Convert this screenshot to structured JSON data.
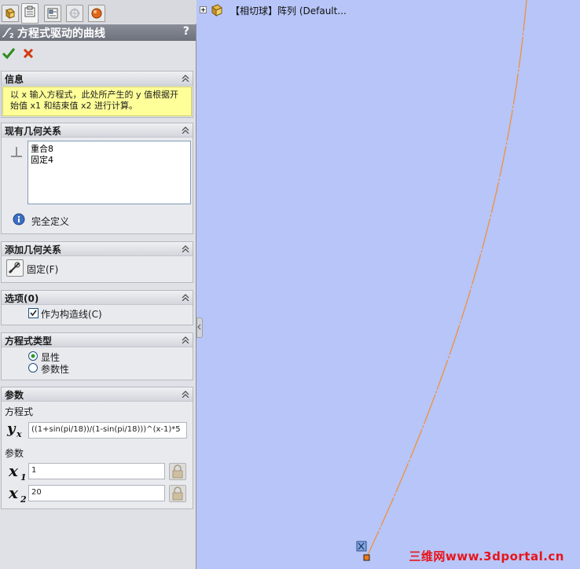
{
  "panel": {
    "title": "方程式驱动的曲线",
    "help": "?",
    "info": {
      "header": "信息",
      "message": "以 x 输入方程式，此处所产生的 y 值根据开始值 x1 和结束值 x2 进行计算。"
    },
    "existing_relations": {
      "header": "现有几何关系",
      "items": [
        "重合8",
        "固定4"
      ],
      "status": "完全定义"
    },
    "add_relations": {
      "header": "添加几何关系",
      "button_label": "固定(F)"
    },
    "options": {
      "header": "选项(0)",
      "construction_label": "作为构造线(C)",
      "construction_checked": true
    },
    "equation_type": {
      "header": "方程式类型",
      "explicit": "显性",
      "parametric": "参数性",
      "selected": "explicit"
    },
    "parameters": {
      "header": "参数",
      "equation_label": "方程式",
      "equation_value": "((1+sin(pi/18))/(1-sin(pi/18)))^(x-1)*5",
      "params_label": "参数",
      "x1_value": "1",
      "x2_value": "20"
    }
  },
  "tree": {
    "label": "【相切球】阵列  (Default..."
  },
  "watermark": "三维网www.3dportal.cn",
  "colors": {
    "canvas": "#b7c5f8",
    "curve": "#f0913a",
    "info_bg": "#ffff99"
  }
}
